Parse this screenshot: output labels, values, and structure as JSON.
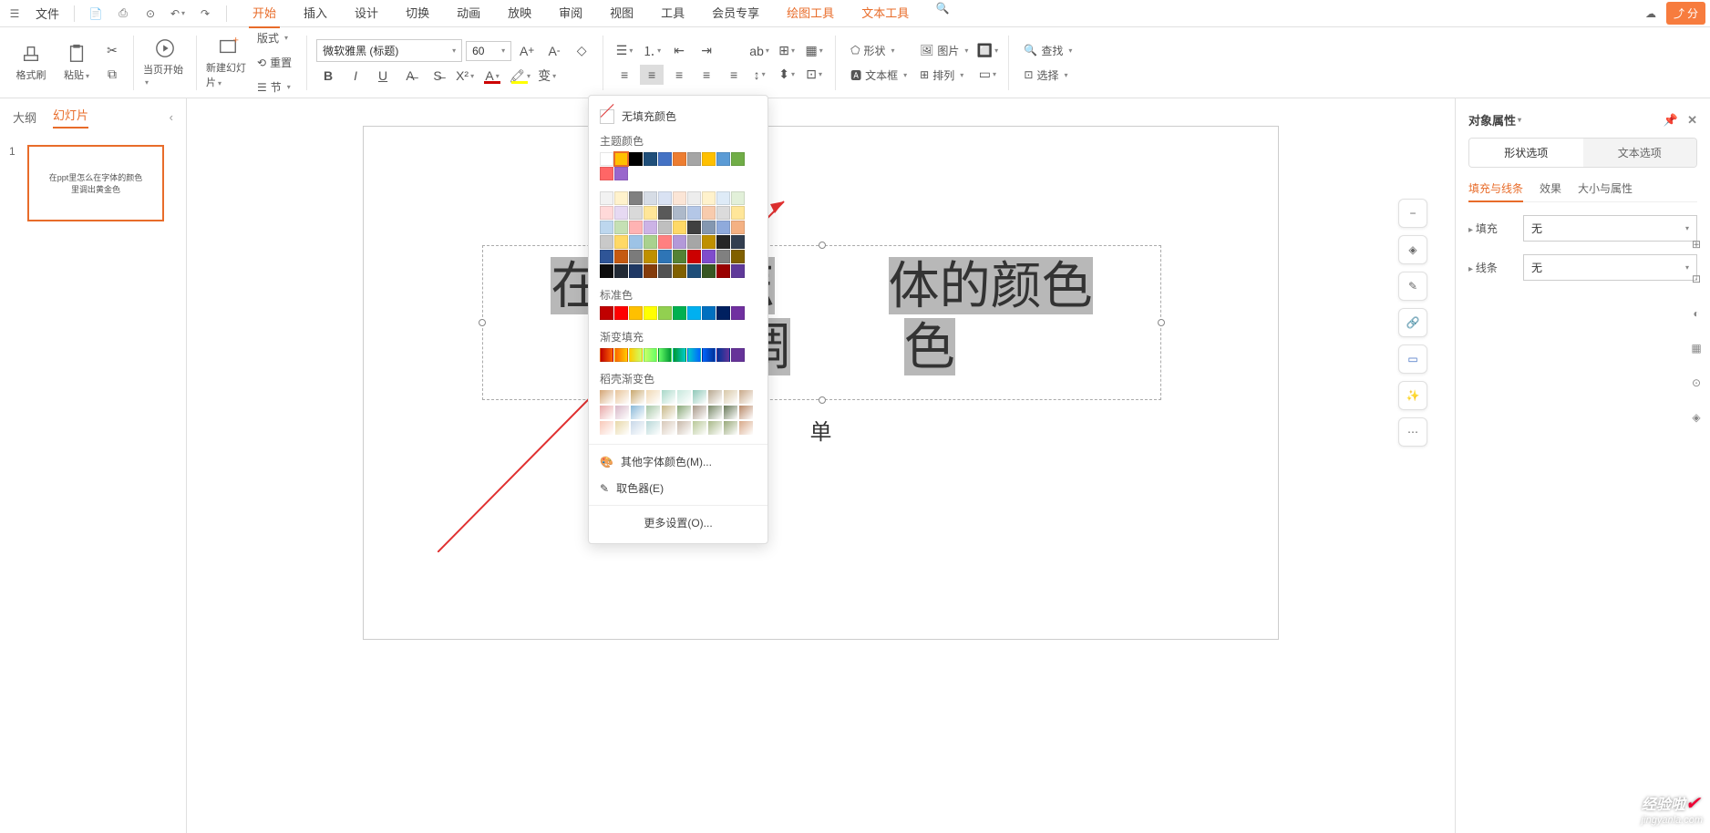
{
  "menubar": {
    "file_label": "文件",
    "tabs": [
      "开始",
      "插入",
      "设计",
      "切换",
      "动画",
      "放映",
      "审阅",
      "视图",
      "工具",
      "会员专享"
    ],
    "extra_tabs": [
      "绘图工具",
      "文本工具"
    ],
    "share_label": "分"
  },
  "ribbon": {
    "format_painter": "格式刷",
    "paste": "粘贴",
    "from_current": "当页开始",
    "new_slide": "新建幻灯片",
    "layout": "版式",
    "reset": "重置",
    "section": "节",
    "font_name": "微软雅黑 (标题)",
    "font_size": "60",
    "shape": "形状",
    "picture": "图片",
    "textbox": "文本框",
    "arrange": "排列",
    "find": "查找",
    "select": "选择"
  },
  "leftpanel": {
    "tab_outline": "大纲",
    "tab_slides": "幻灯片",
    "thumb_num": "1",
    "thumb_line1": "在ppt里怎么在字体的颜色",
    "thumb_line2": "里调出黄金色"
  },
  "slide": {
    "title_part1": "在ppt里怎",
    "title_part2": "体的颜色",
    "title_part3": "里调",
    "title_part4": "色",
    "subtitle": "单"
  },
  "colorpop": {
    "no_fill": "无填充颜色",
    "theme_colors": "主题颜色",
    "standard_colors": "标准色",
    "gradient_fill": "渐变填充",
    "dotshell_gradient": "稻壳渐变色",
    "more_colors": "其他字体颜色(M)...",
    "eyedropper": "取色器(E)",
    "more_settings": "更多设置(O)...",
    "theme_row1": [
      "#ffffff",
      "#ffc000",
      "#000000",
      "#1f4e79",
      "#4472c4",
      "#ed7d31",
      "#a5a5a5",
      "#ffc000",
      "#5b9bd5",
      "#70ad47",
      "#ff6666",
      "#9966cc"
    ],
    "theme_shades": [
      [
        "#f2f2f2",
        "#fff2cc",
        "#808080",
        "#d6dce5",
        "#d9e2f3",
        "#fbe5d6",
        "#ededed",
        "#fff2cc",
        "#deebf7",
        "#e2f0d9",
        "#ffd9d9",
        "#e6d9f2"
      ],
      [
        "#d9d9d9",
        "#ffe699",
        "#595959",
        "#adb9ca",
        "#b4c7e7",
        "#f8cbad",
        "#dbdbdb",
        "#ffe699",
        "#bdd7ee",
        "#c5e0b4",
        "#ffb3b3",
        "#ccb3e6"
      ],
      [
        "#bfbfbf",
        "#ffd966",
        "#404040",
        "#8497b0",
        "#8faadc",
        "#f4b183",
        "#c9c9c9",
        "#ffd966",
        "#9dc3e6",
        "#a9d18e",
        "#ff8080",
        "#b399d9"
      ],
      [
        "#a6a6a6",
        "#bf9000",
        "#262626",
        "#333f50",
        "#2f5597",
        "#c55a11",
        "#7b7b7b",
        "#bf9000",
        "#2e75b6",
        "#548235",
        "#cc0000",
        "#7f4ccc"
      ],
      [
        "#808080",
        "#806000",
        "#0d0d0d",
        "#222a35",
        "#1f3864",
        "#843c0c",
        "#525252",
        "#806000",
        "#1f4e79",
        "#385723",
        "#990000",
        "#5f3999"
      ]
    ],
    "standard_row": [
      "#c00000",
      "#ff0000",
      "#ffc000",
      "#ffff00",
      "#92d050",
      "#00b050",
      "#00b0f0",
      "#0070c0",
      "#002060",
      "#7030a0"
    ],
    "gradient_row": [
      "#c00000",
      "#ff6600",
      "#ffcc00",
      "#ccff66",
      "#66ff66",
      "#009933",
      "#00cccc",
      "#0066ff",
      "#003399",
      "#663399"
    ],
    "dotshell1": [
      "#d4a574",
      "#e8c49a",
      "#c9a86e",
      "#f0d9b5",
      "#a8d8c8",
      "#c8e8dd",
      "#8fc8b8",
      "#b8a890",
      "#d8c8a8",
      "#c8a888"
    ],
    "dotshell2": [
      "#e8a8a8",
      "#d8b8c8",
      "#88b8d8",
      "#a8c8a8",
      "#c8b888",
      "#88a878",
      "#a89888",
      "#788868",
      "#687858",
      "#b88868"
    ],
    "dotshell3": [
      "#f8c8b8",
      "#e8d8a8",
      "#c8d8e8",
      "#b8d8d8",
      "#d8c8b8",
      "#c8b8a8",
      "#b8c898",
      "#a8b888",
      "#98a878",
      "#d8a888"
    ]
  },
  "rightpanel": {
    "title": "对象属性",
    "tab_shape": "形状选项",
    "tab_text": "文本选项",
    "subtab_fill": "填充与线条",
    "subtab_effect": "效果",
    "subtab_size": "大小与属性",
    "field_fill": "填充",
    "field_line": "线条",
    "value_none": "无"
  },
  "watermark": {
    "brand": "经验啦",
    "url": "jingyanla.com"
  }
}
